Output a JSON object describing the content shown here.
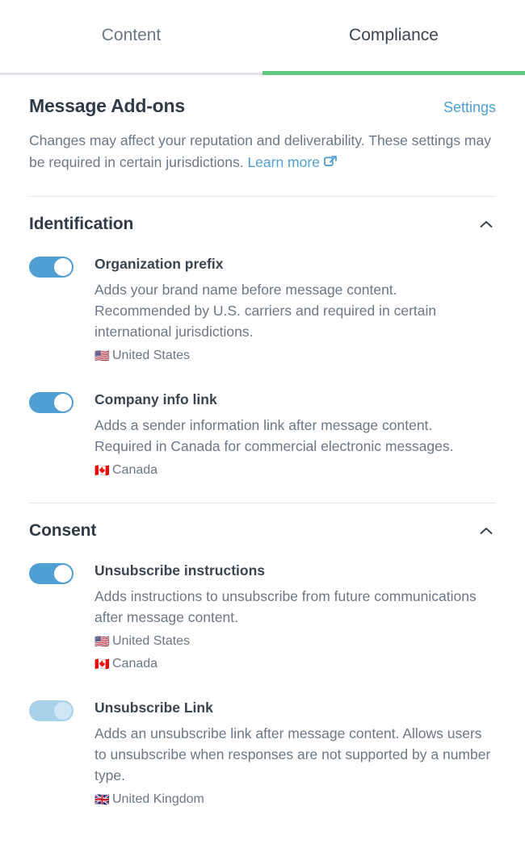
{
  "colors": {
    "accent_green": "#63c87f",
    "link_blue": "#4f9ed4",
    "toggle_on": "#4f9ed4",
    "toggle_disabled": "#a8d2ea",
    "heading": "#2f3b47",
    "body_text": "#6b7785"
  },
  "tabs": [
    {
      "label": "Content",
      "active": false
    },
    {
      "label": "Compliance",
      "active": true
    }
  ],
  "panel": {
    "title": "Message Add-ons",
    "settings_label": "Settings",
    "description_text": "Changes may affect your reputation and deliverability. These settings may be required in certain jurisdictions.",
    "learn_more_label": "Learn more",
    "external_link_icon": "external-link-icon"
  },
  "groups": [
    {
      "title": "Identification",
      "collapse_icon": "chevron-up-icon",
      "expanded": true,
      "items": [
        {
          "title": "Organization prefix",
          "description": "Adds your brand name before message content. Recommended by U.S. carriers and required in certain international jurisdictions.",
          "toggle_state": "on",
          "toggle_disabled": false,
          "regions": [
            {
              "flag": "🇺🇸",
              "name": "United States"
            }
          ]
        },
        {
          "title": "Company info link",
          "description": "Adds a sender information link after message content. Required in Canada for commercial electronic messages.",
          "toggle_state": "on",
          "toggle_disabled": false,
          "regions": [
            {
              "flag": "🇨🇦",
              "name": "Canada"
            }
          ]
        }
      ]
    },
    {
      "title": "Consent",
      "collapse_icon": "chevron-up-icon",
      "expanded": true,
      "items": [
        {
          "title": "Unsubscribe instructions",
          "description": "Adds instructions to unsubscribe from future communications after message content.",
          "toggle_state": "on",
          "toggle_disabled": false,
          "regions": [
            {
              "flag": "🇺🇸",
              "name": "United States"
            },
            {
              "flag": "🇨🇦",
              "name": "Canada"
            }
          ]
        },
        {
          "title": "Unsubscribe Link",
          "description": "Adds an unsubscribe link after message content. Allows users to unsubscribe when responses are not supported by a number type.",
          "toggle_state": "on",
          "toggle_disabled": true,
          "regions": [
            {
              "flag": "🇬🇧",
              "name": "United Kingdom"
            }
          ]
        }
      ]
    }
  ]
}
